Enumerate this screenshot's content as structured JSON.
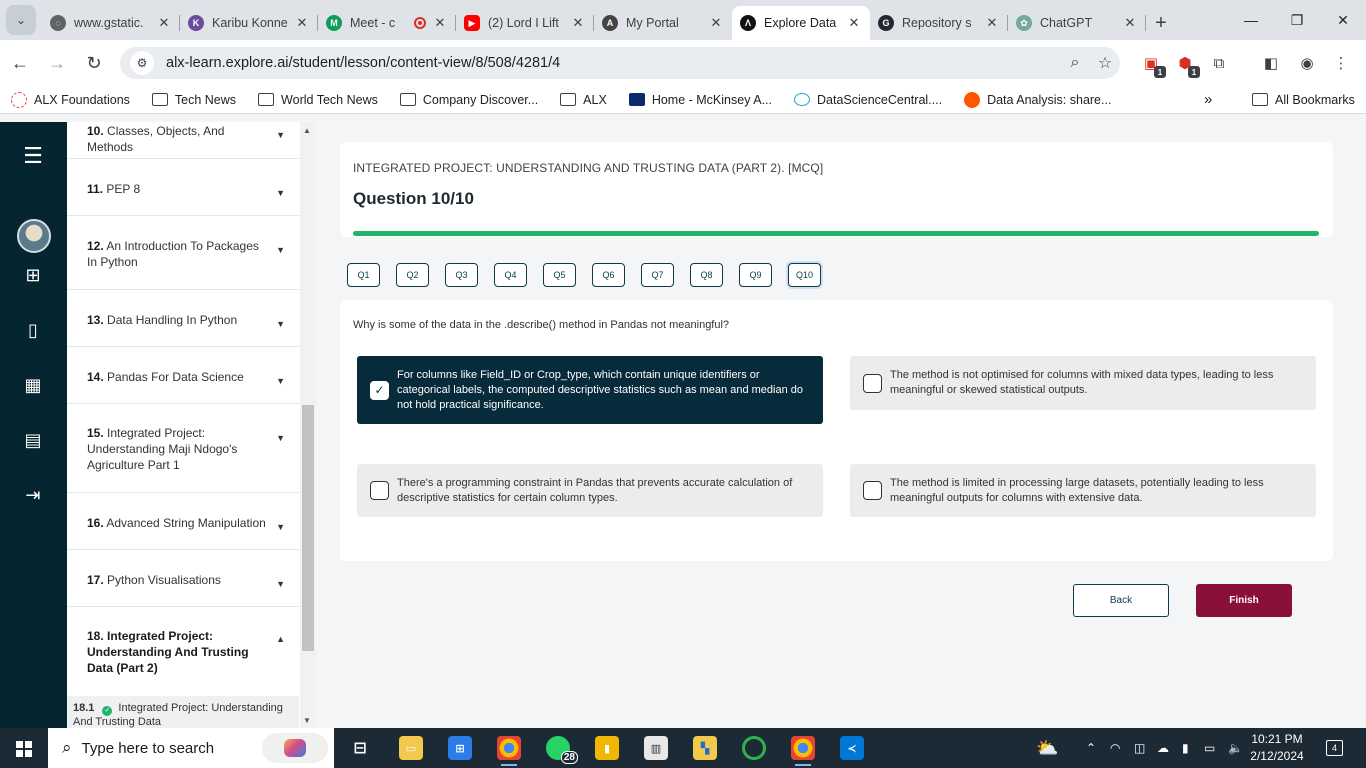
{
  "browser": {
    "tabs": [
      {
        "title": "www.gstatic.",
        "fav_color": "#5f6368"
      },
      {
        "title": "Karibu Konne",
        "fav_color": "#6b4c9a"
      },
      {
        "title": "Meet - c",
        "fav_color": "#0f9d58"
      },
      {
        "title": "(2) Lord I Lift",
        "fav_color": "#ff0000"
      },
      {
        "title": "My Portal",
        "fav_color": "#444444"
      },
      {
        "title": "Explore Data",
        "fav_color": "#111111"
      },
      {
        "title": "Repository s",
        "fav_color": "#24292f"
      },
      {
        "title": "ChatGPT",
        "fav_color": "#74aa9c"
      }
    ],
    "active_tab_index": 5,
    "url": "alx-learn.explore.ai/student/lesson/content-view/8/508/4281/4",
    "ext_badges": [
      "1",
      "1"
    ],
    "bookmarks": [
      "ALX Foundations",
      "Tech News",
      "World Tech News",
      "Company Discover...",
      "ALX",
      "Home - McKinsey A...",
      "DataScienceCentral....",
      "Data Analysis: share..."
    ],
    "all_bookmarks": "All Bookmarks",
    "overflow": "»"
  },
  "sidebar": {
    "lessons": [
      {
        "num": "10.",
        "title": "Classes, Objects, And Methods"
      },
      {
        "num": "11.",
        "title": "PEP 8"
      },
      {
        "num": "12.",
        "title": "An Introduction To Packages In Python"
      },
      {
        "num": "13.",
        "title": "Data Handling In Python"
      },
      {
        "num": "14.",
        "title": "Pandas For Data Science"
      },
      {
        "num": "15.",
        "title": "Integrated Project: Understanding Maji Ndogo's Agriculture Part 1"
      },
      {
        "num": "16.",
        "title": "Advanced String Manipulation"
      },
      {
        "num": "17.",
        "title": "Python Visualisations"
      },
      {
        "num": "18.",
        "title": "Integrated Project: Understanding And Trusting Data (Part 2)"
      }
    ],
    "sub_item": {
      "num": "18.1",
      "title": "Integrated Project: Understanding And Trusting Data"
    }
  },
  "quiz": {
    "breadcrumb": "INTEGRATED PROJECT: UNDERSTANDING AND TRUSTING DATA (PART 2). [MCQ]",
    "title": "Question 10/10",
    "progress": 1.0,
    "progress_color": "#21b46a",
    "question_nav": [
      "Q1",
      "Q2",
      "Q3",
      "Q4",
      "Q5",
      "Q6",
      "Q7",
      "Q8",
      "Q9",
      "Q10"
    ],
    "current_question": "Q10",
    "question": "Why is some of the data in the .describe() method in Pandas not meaningful?",
    "options": [
      {
        "text": "For columns like Field_ID or Crop_type, which contain unique identifiers or categorical labels, the computed descriptive statistics such as mean and median do not hold practical significance.",
        "selected": true
      },
      {
        "text": "The method is not optimised for columns with mixed data types, leading to less meaningful or skewed statistical outputs.",
        "selected": false
      },
      {
        "text": "There's a programming constraint in Pandas that prevents accurate calculation of descriptive statistics for certain column types.",
        "selected": false
      },
      {
        "text": "The method is limited in processing large datasets, potentially leading to less meaningful outputs for columns with extensive data.",
        "selected": false
      }
    ],
    "back_label": "Back",
    "finish_label": "Finish",
    "accent_color": "#072b3a",
    "finish_color": "#8a0f3a"
  },
  "taskbar": {
    "search_placeholder": "Type here to search",
    "whatsapp_badge": "28",
    "time": "10:21 PM",
    "date": "2/12/2024",
    "notifications": "4"
  }
}
